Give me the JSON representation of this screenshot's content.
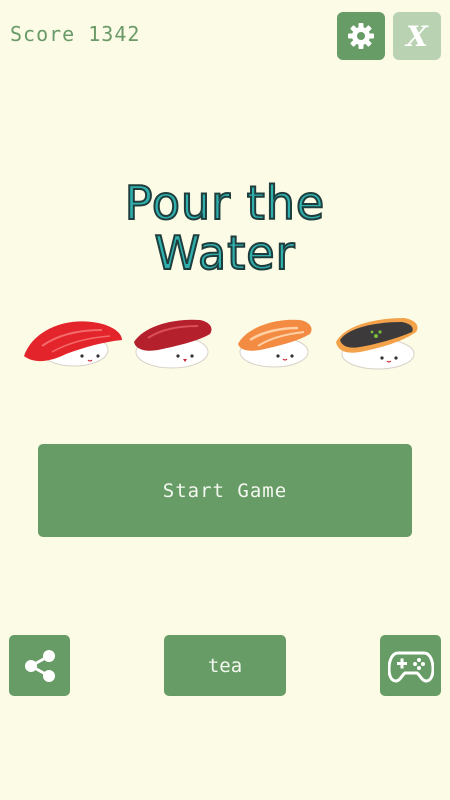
{
  "hud": {
    "score_text": "Score 1342",
    "settings_icon": "gear-icon",
    "close_label": "X"
  },
  "title": {
    "line1": "Pour the",
    "line2": "Water"
  },
  "sushi": [
    "tuna-sushi",
    "akami-sushi",
    "salmon-sushi",
    "eel-sushi"
  ],
  "buttons": {
    "start": "Start Game",
    "tea": "tea",
    "share_icon": "share-icon",
    "gamepad_icon": "gamepad-icon"
  },
  "colors": {
    "background": "#fcfbe6",
    "button": "#679c66",
    "button_disabled": "#b9d3b2",
    "title_fill": "#2fb0ad"
  }
}
